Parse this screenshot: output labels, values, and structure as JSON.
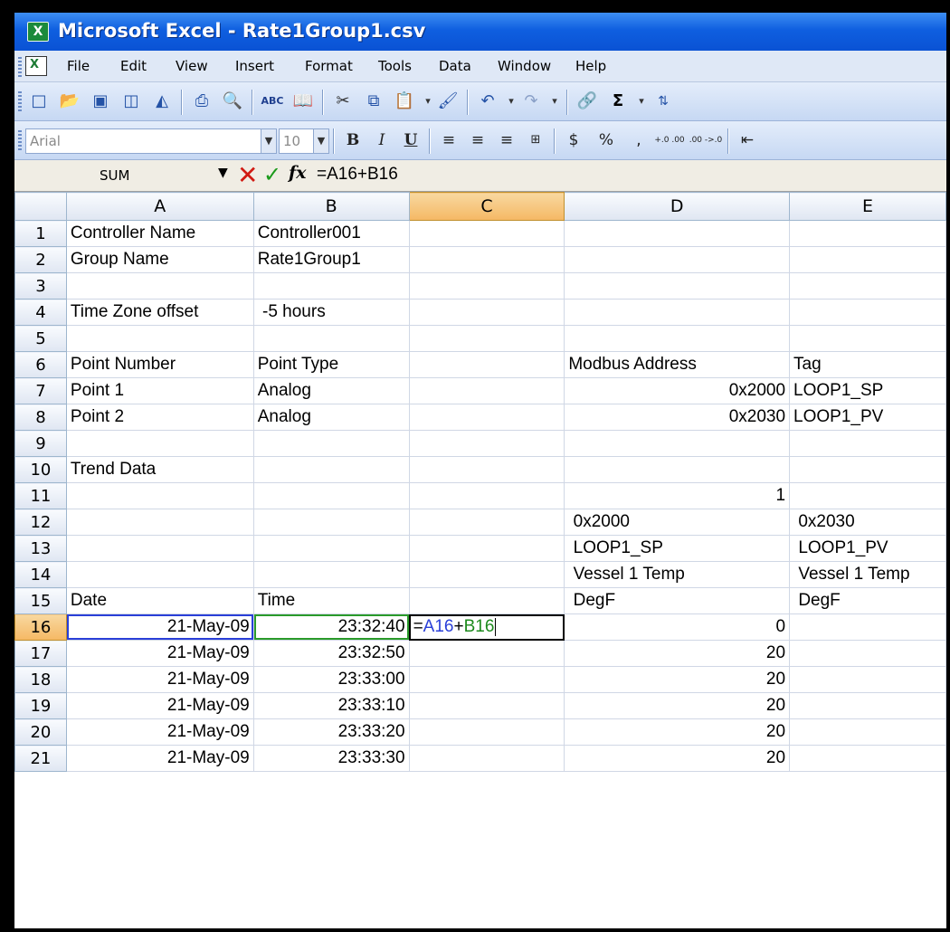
{
  "window": {
    "title": "Microsoft Excel - Rate1Group1.csv",
    "app_icon": "X"
  },
  "menu": [
    "File",
    "Edit",
    "View",
    "Insert",
    "Format",
    "Tools",
    "Data",
    "Window",
    "Help"
  ],
  "format_bar": {
    "font": "Arial",
    "size": "10",
    "bold": "B",
    "italic": "I",
    "underline": "U",
    "currency": "$",
    "percent": "%",
    "comma": ",",
    "inc_decimal": "+.0 .00",
    "dec_decimal": ".00 ->.0"
  },
  "standard_toolbar": {
    "autosum": "Σ",
    "spelling_label": "ABC"
  },
  "formula_bar": {
    "name_box": "SUM",
    "fx": "fx",
    "formula": "=A16+B16"
  },
  "sheet": {
    "columns": [
      "A",
      "B",
      "C",
      "D",
      "E"
    ],
    "selected_column": "C",
    "active_row": "16",
    "rows": [
      {
        "num": "1",
        "A": "Controller Name",
        "B": "Controller001",
        "C": "",
        "D": "",
        "E": ""
      },
      {
        "num": "2",
        "A": "Group Name",
        "B": "Rate1Group1",
        "C": "",
        "D": "",
        "E": ""
      },
      {
        "num": "3",
        "A": "",
        "B": "",
        "C": "",
        "D": "",
        "E": ""
      },
      {
        "num": "4",
        "A": "Time Zone offset",
        "B": " -5 hours",
        "C": "",
        "D": "",
        "E": ""
      },
      {
        "num": "5",
        "A": "",
        "B": "",
        "C": "",
        "D": "",
        "E": ""
      },
      {
        "num": "6",
        "A": "Point Number",
        "B": "Point Type",
        "C": "",
        "D": "Modbus Address",
        "E": "Tag"
      },
      {
        "num": "7",
        "A": "Point 1",
        "B": "Analog",
        "C": "",
        "D": "0x2000",
        "E": "LOOP1_SP"
      },
      {
        "num": "8",
        "A": "Point 2",
        "B": "Analog",
        "C": "",
        "D": "0x2030",
        "E": "LOOP1_PV"
      },
      {
        "num": "9",
        "A": "",
        "B": "",
        "C": "",
        "D": "",
        "E": ""
      },
      {
        "num": "10",
        "A": "Trend Data",
        "B": "",
        "C": "",
        "D": "",
        "E": ""
      },
      {
        "num": "11",
        "A": "",
        "B": "",
        "C": "",
        "D": "1",
        "E": ""
      },
      {
        "num": "12",
        "A": "",
        "B": "",
        "C": "",
        "D": " 0x2000",
        "E": " 0x2030"
      },
      {
        "num": "13",
        "A": "",
        "B": "",
        "C": "",
        "D": " LOOP1_SP",
        "E": " LOOP1_PV"
      },
      {
        "num": "14",
        "A": "",
        "B": "",
        "C": "",
        "D": " Vessel 1 Temp",
        "E": " Vessel 1 Temp"
      },
      {
        "num": "15",
        "A": "Date",
        "B": "Time",
        "C": "",
        "D": " DegF",
        "E": " DegF"
      },
      {
        "num": "16",
        "A": "21-May-09",
        "B": "23:32:40",
        "C": "",
        "D": "0",
        "E": ""
      },
      {
        "num": "17",
        "A": "21-May-09",
        "B": "23:32:50",
        "C": "",
        "D": "20",
        "E": ""
      },
      {
        "num": "18",
        "A": "21-May-09",
        "B": "23:33:00",
        "C": "",
        "D": "20",
        "E": ""
      },
      {
        "num": "19",
        "A": "21-May-09",
        "B": "23:33:10",
        "C": "",
        "D": "20",
        "E": ""
      },
      {
        "num": "20",
        "A": "21-May-09",
        "B": "23:33:20",
        "C": "",
        "D": "20",
        "E": ""
      },
      {
        "num": "21",
        "A": "21-May-09",
        "B": "23:33:30",
        "C": "",
        "D": "20",
        "E": ""
      }
    ],
    "edit_cell": {
      "eq": "=",
      "refA": "A16",
      "plus": "+",
      "refB": "B16"
    },
    "numeric_columns": [
      "A",
      "B",
      "D"
    ]
  }
}
